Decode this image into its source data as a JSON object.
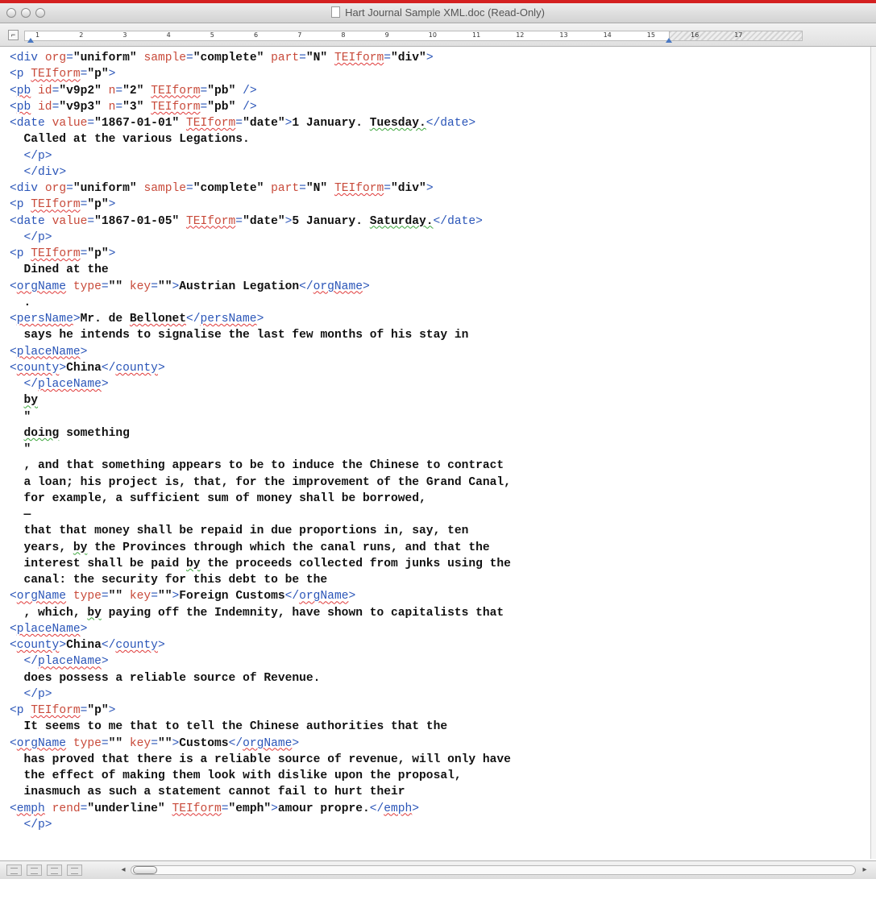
{
  "window": {
    "title": "Hart Journal Sample XML.doc (Read-Only)",
    "traffic_lights": [
      "close",
      "minimize",
      "zoom"
    ]
  },
  "colors": {
    "accent": "#d42020",
    "tag": "#2a55b8",
    "attr_name": "#c84a3a",
    "text": "#111111",
    "spell_red": "#e03a3a",
    "spell_green": "#3aa53a"
  },
  "ruler": {
    "numbers": [
      "1",
      "2",
      "3",
      "4",
      "5",
      "6",
      "7",
      "8",
      "9",
      "10",
      "11",
      "12",
      "13",
      "14",
      "15",
      "16",
      "17"
    ],
    "tab_selector": "⌐"
  },
  "document": {
    "lines": [
      "<div org=\"uniform\" sample=\"complete\" part=\"N\" TEIform=\"div\">",
      "<p TEIform=\"p\">",
      "<pb id=\"v9p2\" n=\"2\" TEIform=\"pb\" />",
      "<pb id=\"v9p3\" n=\"3\" TEIform=\"pb\" />",
      "<date value=\"1867-01-01\" TEIform=\"date\">1 January. Tuesday.</date>",
      "  Called at the various Legations.",
      "  </p>",
      "  </div>",
      "<div org=\"uniform\" sample=\"complete\" part=\"N\" TEIform=\"div\">",
      "<p TEIform=\"p\">",
      "<date value=\"1867-01-05\" TEIform=\"date\">5 January. Saturday.</date>",
      "  </p>",
      "<p TEIform=\"p\">",
      "  Dined at the",
      "<orgName type=\"\" key=\"\">Austrian Legation</orgName>",
      "  .",
      "<persName>Mr. de Bellonet</persName>",
      "  says he intends to signalise the last few months of his stay in",
      "<placeName>",
      "<county>China</county>",
      "  </placeName>",
      "  by",
      "  \"",
      "  doing something",
      "  \"",
      "  , and that something appears to be to induce the Chinese to contract",
      "  a loan; his project is, that, for the improvement of the Grand Canal,",
      "  for example, a sufficient sum of money shall be borrowed,",
      "  —",
      "  that that money shall be repaid in due proportions in, say, ten",
      "  years, by the Provinces through which the canal runs, and that the",
      "  interest shall be paid by the proceeds collected from junks using the",
      "  canal: the security for this debt to be the",
      "<orgName type=\"\" key=\"\">Foreign Customs</orgName>",
      "  , which, by paying off the Indemnity, have shown to capitalists that",
      "<placeName>",
      "<county>China</county>",
      "  </placeName>",
      "  does possess a reliable source of Revenue.",
      "  </p>",
      "<p TEIform=\"p\">",
      "  It seems to me that to tell the Chinese authorities that the",
      "<orgName type=\"\" key=\"\">Customs</orgName>",
      "  has proved that there is a reliable source of revenue, will only have",
      "  the effect of making them look with dislike upon the proposal,",
      "  inasmuch as such a statement cannot fail to hurt their",
      "<emph rend=\"underline\" TEIform=\"emph\">amour propre.</emph>",
      "  </p>"
    ],
    "misspelled": [
      "TEIform",
      "pb",
      "orgName",
      "persName",
      "placeName",
      "county",
      "emph",
      "Bellonet"
    ],
    "grammar_flagged": [
      "Tuesday.",
      "Saturday.",
      "by",
      "doing"
    ]
  },
  "status_bar": {
    "view_buttons": [
      "draft-view",
      "outline-view",
      "publishing-view",
      "print-layout-view"
    ]
  }
}
